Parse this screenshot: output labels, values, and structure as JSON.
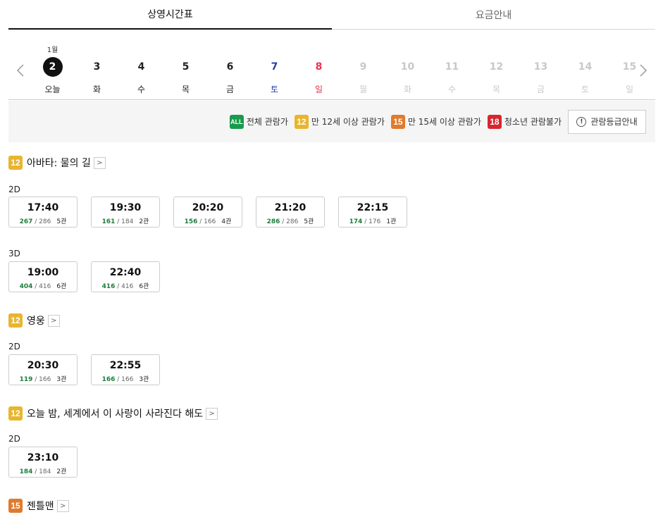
{
  "tabs": [
    {
      "label": "상영시간표",
      "active": true
    },
    {
      "label": "요금안내",
      "active": false
    }
  ],
  "datebar": {
    "prev_icon": "chevron-left-icon",
    "next_icon": "chevron-right-icon",
    "days": [
      {
        "month": "1월",
        "num": "2",
        "dow": "오늘",
        "state": "selected"
      },
      {
        "month": "",
        "num": "3",
        "dow": "화",
        "state": "normal"
      },
      {
        "month": "",
        "num": "4",
        "dow": "수",
        "state": "normal"
      },
      {
        "month": "",
        "num": "5",
        "dow": "목",
        "state": "normal"
      },
      {
        "month": "",
        "num": "6",
        "dow": "금",
        "state": "normal"
      },
      {
        "month": "",
        "num": "7",
        "dow": "토",
        "state": "sat"
      },
      {
        "month": "",
        "num": "8",
        "dow": "일",
        "state": "sun"
      },
      {
        "month": "",
        "num": "9",
        "dow": "월",
        "state": "disabled"
      },
      {
        "month": "",
        "num": "10",
        "dow": "화",
        "state": "disabled"
      },
      {
        "month": "",
        "num": "11",
        "dow": "수",
        "state": "disabled"
      },
      {
        "month": "",
        "num": "12",
        "dow": "목",
        "state": "disabled"
      },
      {
        "month": "",
        "num": "13",
        "dow": "금",
        "state": "disabled"
      },
      {
        "month": "",
        "num": "14",
        "dow": "토",
        "state": "disabled"
      },
      {
        "month": "",
        "num": "15",
        "dow": "일",
        "state": "disabled"
      }
    ]
  },
  "legend": {
    "items": [
      {
        "badge": "ALL",
        "cls": "b-all",
        "label": "전체 관람가"
      },
      {
        "badge": "12",
        "cls": "b-12",
        "label": "만 12세 이상 관람가"
      },
      {
        "badge": "15",
        "cls": "b-15",
        "label": "만 15세 이상 관람가"
      },
      {
        "badge": "18",
        "cls": "b-18",
        "label": "청소년 관람불가"
      }
    ],
    "guide_label": "관람등급안내",
    "guide_icon_text": "!"
  },
  "movies": [
    {
      "rating": "12",
      "rating_cls": "b-12",
      "title": "아바타: 물의 길",
      "groups": [
        {
          "format": "2D",
          "slots": [
            {
              "time": "17:40",
              "seats": "267",
              "total": "286",
              "hall": "5관"
            },
            {
              "time": "19:30",
              "seats": "161",
              "total": "184",
              "hall": "2관"
            },
            {
              "time": "20:20",
              "seats": "156",
              "total": "166",
              "hall": "4관"
            },
            {
              "time": "21:20",
              "seats": "286",
              "total": "286",
              "hall": "5관"
            },
            {
              "time": "22:15",
              "seats": "174",
              "total": "176",
              "hall": "1관"
            }
          ]
        },
        {
          "format": "3D",
          "slots": [
            {
              "time": "19:00",
              "seats": "404",
              "total": "416",
              "hall": "6관"
            },
            {
              "time": "22:40",
              "seats": "416",
              "total": "416",
              "hall": "6관"
            }
          ]
        }
      ]
    },
    {
      "rating": "12",
      "rating_cls": "b-12",
      "title": "영웅",
      "groups": [
        {
          "format": "2D",
          "slots": [
            {
              "time": "20:30",
              "seats": "119",
              "total": "166",
              "hall": "3관"
            },
            {
              "time": "22:55",
              "seats": "166",
              "total": "166",
              "hall": "3관"
            }
          ]
        }
      ]
    },
    {
      "rating": "12",
      "rating_cls": "b-12",
      "title": "오늘 밤, 세계에서 이 사랑이 사라진다 해도",
      "groups": [
        {
          "format": "2D",
          "slots": [
            {
              "time": "23:10",
              "seats": "184",
              "total": "184",
              "hall": "2관"
            }
          ]
        }
      ]
    },
    {
      "rating": "15",
      "rating_cls": "b-15",
      "title": "젠틀맨",
      "groups": []
    }
  ]
}
